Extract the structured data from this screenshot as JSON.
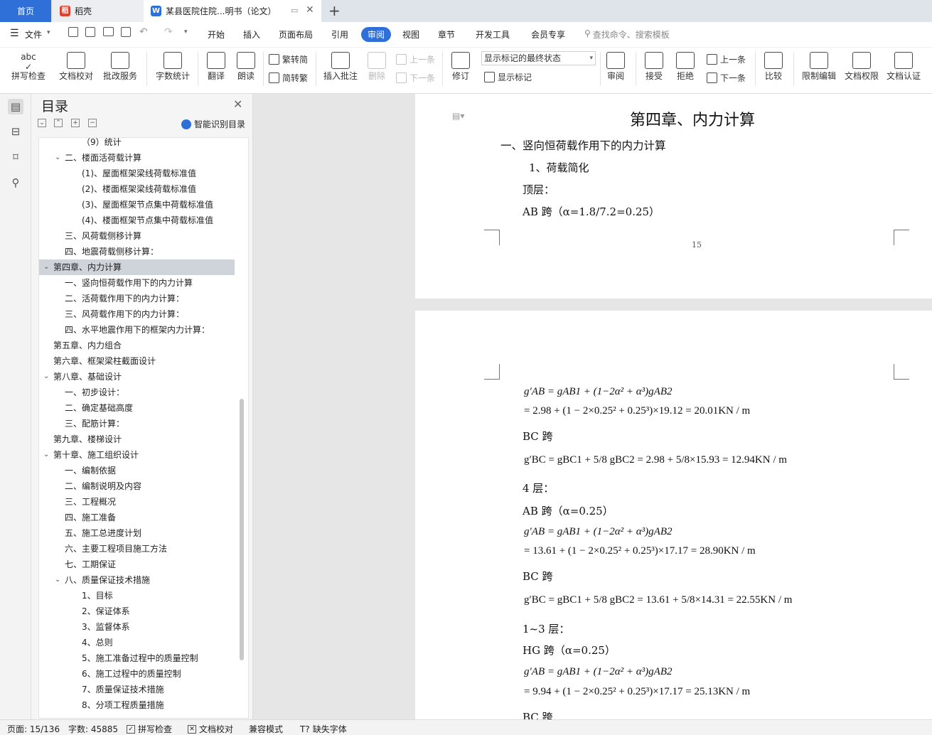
{
  "tabs": {
    "home": "首页",
    "daoke": "稻壳",
    "doc": "某县医院住院...明书（论文）",
    "add": "+"
  },
  "menu": {
    "file": "文件",
    "items": [
      "开始",
      "插入",
      "页面布局",
      "引用",
      "审阅",
      "视图",
      "章节",
      "开发工具",
      "会员专享"
    ],
    "search": "查找命令、搜索模板"
  },
  "ribbon": {
    "spellcheck": "拼写检查",
    "doc_proof": "文档校对",
    "batch_service": "批改服务",
    "word_count": "字数统计",
    "translate": "翻译",
    "read_aloud": "朗读",
    "trad_to_simp": "繁转简",
    "simp_to_trad": "简转繁",
    "insert_comment": "插入批注",
    "delete": "删除",
    "prev_comment": "上一条",
    "next_comment": "下一条",
    "revise": "修订",
    "markup_state": "显示标记的最终状态",
    "show_markup": "显示标记",
    "review": "审阅",
    "accept": "接受",
    "reject": "拒绝",
    "prev_change": "上一条",
    "next_change": "下一条",
    "compare": "比较",
    "restrict_edit": "限制编辑",
    "doc_permission": "文档权限",
    "doc_cert": "文档认证"
  },
  "toc": {
    "title": "目录",
    "smart": "智能识别目录",
    "items": [
      {
        "text": "（9）统计",
        "level": 3
      },
      {
        "text": "二、楼面活荷载计算",
        "level": 2,
        "expand": true
      },
      {
        "text": "(1)、屋面框架梁线荷载标准值",
        "level": 3
      },
      {
        "text": "(2)、楼面框架梁线荷载标准值",
        "level": 3
      },
      {
        "text": "(3)、屋面框架节点集中荷载标准值",
        "level": 3
      },
      {
        "text": "(4)、楼面框架节点集中荷载标准值",
        "level": 3
      },
      {
        "text": "三、风荷载侧移计算",
        "level": 2
      },
      {
        "text": "四、地震荷载侧移计算：",
        "level": 2
      },
      {
        "text": "第四章、内力计算",
        "level": 1,
        "expand": true,
        "selected": true
      },
      {
        "text": "一、竖向恒荷载作用下的内力计算",
        "level": 2
      },
      {
        "text": "二、活荷载作用下的内力计算：",
        "level": 2
      },
      {
        "text": "三、风荷载作用下的内力计算：",
        "level": 2
      },
      {
        "text": "四、水平地震作用下的框架内力计算：",
        "level": 2
      },
      {
        "text": "第五章、内力组合",
        "level": 1
      },
      {
        "text": "第六章、框架梁柱截面设计",
        "level": 1
      },
      {
        "text": "第八章、基础设计",
        "level": 1,
        "expand": true
      },
      {
        "text": "一、初步设计：",
        "level": 2
      },
      {
        "text": "二、确定基础高度",
        "level": 2
      },
      {
        "text": "三、配筋计算：",
        "level": 2
      },
      {
        "text": "第九章、楼梯设计",
        "level": 1
      },
      {
        "text": "第十章、施工组织设计",
        "level": 1,
        "expand": true
      },
      {
        "text": "一、编制依据",
        "level": 2
      },
      {
        "text": "二、编制说明及内容",
        "level": 2
      },
      {
        "text": "三、工程概况",
        "level": 2
      },
      {
        "text": "四、施工准备",
        "level": 2
      },
      {
        "text": "五、施工总进度计划",
        "level": 2
      },
      {
        "text": "六、主要工程项目施工方法",
        "level": 2
      },
      {
        "text": "七、工期保证",
        "level": 2
      },
      {
        "text": "八、质量保证技术措施",
        "level": 2,
        "expand": true
      },
      {
        "text": "1、目标",
        "level": 3
      },
      {
        "text": "2、保证体系",
        "level": 3
      },
      {
        "text": "3、监督体系",
        "level": 3
      },
      {
        "text": "4、总则",
        "level": 3
      },
      {
        "text": "5、施工准备过程中的质量控制",
        "level": 3
      },
      {
        "text": "6、施工过程中的质量控制",
        "level": 3
      },
      {
        "text": "7、质量保证技术措施",
        "level": 3
      },
      {
        "text": "8、分项工程质量措施",
        "level": 3
      }
    ]
  },
  "doc": {
    "chapter_title": "第四章、内力计算",
    "section1": "一、竖向恒荷载作用下的内力计算",
    "sub1": "1、荷载简化",
    "top_floor": "顶层：",
    "ab_span_top": "AB 跨（α=1.8/7.2=0.25）",
    "page_number": "15",
    "eq1a": "g′AB = gAB1 + (1−2α² + α³)gAB2",
    "eq1b": "= 2.98 + (1 − 2×0.25² + 0.25³)×19.12 = 20.01KN / m",
    "bc1": "BC 跨",
    "eq2": "g′BC = gBC1 + 5/8 gBC2 = 2.98 + 5/8×15.93 = 12.94KN / m",
    "floor4": "4 层：",
    "ab4": "AB 跨（α=0.25）",
    "eq3a": "g′AB = gAB1 + (1−2α² + α³)gAB2",
    "eq3b": "= 13.61 + (1 − 2×0.25² + 0.25³)×17.17 = 28.90KN / m",
    "bc4": "BC 跨",
    "eq4": "g′BC = gBC1 + 5/8 gBC2 = 13.61 + 5/8×14.31 = 22.55KN / m",
    "floor13": "1~3 层：",
    "hg": "HG 跨（α=0.25）",
    "eq5a": "g′AB = gAB1 + (1−2α² + α³)gAB2",
    "eq5b": "= 9.94 + (1 − 2×0.25² + 0.25³)×17.17 = 25.13KN / m",
    "bc_cut": "BC 跨"
  },
  "status": {
    "page": "页面: 15/136",
    "words": "字数: 45885",
    "spell": "拼写检查",
    "proof": "文档校对",
    "compat": "兼容模式",
    "missing_font": "缺失字体"
  }
}
